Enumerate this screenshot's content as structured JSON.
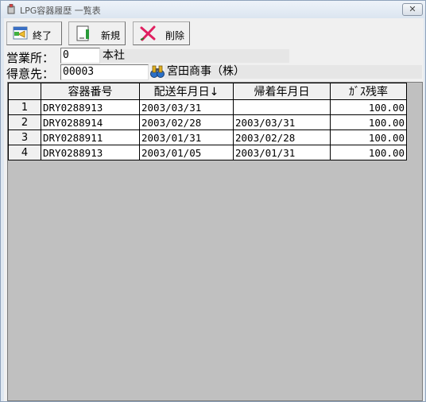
{
  "window": {
    "title": "LPG容器履歴 一覧表",
    "close_glyph": "✕"
  },
  "toolbar": {
    "exit_label": "終了",
    "new_label": "新規",
    "delete_label": "削除"
  },
  "form": {
    "office_label": "営業所：",
    "office_code": "0",
    "office_name": "本社",
    "customer_label": "得意先：",
    "customer_code": "00003",
    "customer_name": "宮田商事（株）"
  },
  "grid": {
    "columns": [
      "",
      "容器番号",
      "配送年月日↓",
      "帰着年月日",
      "ｶﾞｽ残率"
    ],
    "rows": [
      {
        "no": "1",
        "container": "DRY0288913",
        "delivery": "2003/03/31",
        "return": "",
        "gas": "100.00"
      },
      {
        "no": "2",
        "container": "DRY0288914",
        "delivery": "2003/02/28",
        "return": "2003/03/31",
        "gas": "100.00"
      },
      {
        "no": "3",
        "container": "DRY0288911",
        "delivery": "2003/01/31",
        "return": "2003/02/28",
        "gas": "100.00"
      },
      {
        "no": "4",
        "container": "DRY0288913",
        "delivery": "2003/01/05",
        "return": "2003/01/31",
        "gas": "100.00"
      }
    ]
  },
  "icons": {
    "app": "app-icon",
    "exit": "exit-icon",
    "new": "new-document-icon",
    "delete": "delete-x-icon",
    "search": "binoculars-search-icon"
  }
}
